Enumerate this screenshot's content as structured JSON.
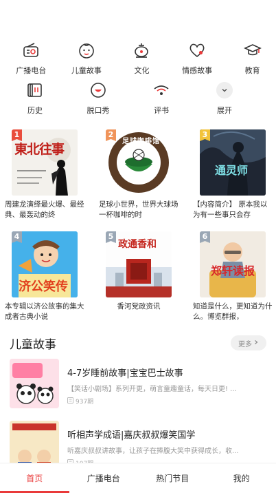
{
  "categories": [
    {
      "label": "广播电台",
      "icon": "radio-icon"
    },
    {
      "label": "儿童故事",
      "icon": "child-face-icon"
    },
    {
      "label": "文化",
      "icon": "teapot-icon"
    },
    {
      "label": "情感故事",
      "icon": "heart-icon"
    },
    {
      "label": "教育",
      "icon": "graduation-cap-icon"
    },
    {
      "label": "历史",
      "icon": "scroll-icon"
    },
    {
      "label": "脱口秀",
      "icon": "smile-bubble-icon"
    },
    {
      "label": "评书",
      "icon": "broadcast-icon"
    },
    {
      "label": "展开",
      "icon": "chevron-down-icon"
    }
  ],
  "ranking": [
    {
      "rank": "1",
      "title": "周建龙演绎最火爆、最经典、最轰动的终",
      "cover_text": "東北往事",
      "badge_color": "#e94d3c"
    },
    {
      "rank": "2",
      "title": "足球小世界，世界大球场 一杯咖啡的时",
      "cover_text": "足球咖啡馆",
      "badge_color": "#f0945a"
    },
    {
      "rank": "3",
      "title": "【内容简介】 原本我以为有一些事只会存",
      "cover_text": "通灵师",
      "badge_color": "#f2c33a"
    },
    {
      "rank": "4",
      "title": "本专辑以济公故事的集大成者古典小说",
      "cover_text": "济公笑传",
      "badge_color": "#9aa7b5"
    },
    {
      "rank": "5",
      "title": "香河党政资讯",
      "cover_text": "政通香和",
      "badge_color": "#9aa7b5"
    },
    {
      "rank": "6",
      "title": "知道是什么，更知道为什么。博览群报，",
      "cover_text": "郑轩读报",
      "badge_color": "#9aa7b5"
    }
  ],
  "section": {
    "title": "儿童故事",
    "more": "更多"
  },
  "programs": [
    {
      "title": "4-7岁睡前故事|宝宝巴士故事",
      "desc": "【笑话小剧场】系列开更，萌言童趣童话，每天日更! ...",
      "count": "937期"
    },
    {
      "title": "听相声学成语|嘉庆叔叔爆笑国学",
      "desc": "听嘉庆叔叔讲故事，让孩子在捧腹大笑中获得成长，收...",
      "count": "107期"
    }
  ],
  "bottom_nav": [
    {
      "label": "首页",
      "active": true
    },
    {
      "label": "广播电台",
      "active": false
    },
    {
      "label": "热门节目",
      "active": false
    },
    {
      "label": "我的",
      "active": false
    }
  ],
  "colors": {
    "accent": "#e93a3a"
  }
}
